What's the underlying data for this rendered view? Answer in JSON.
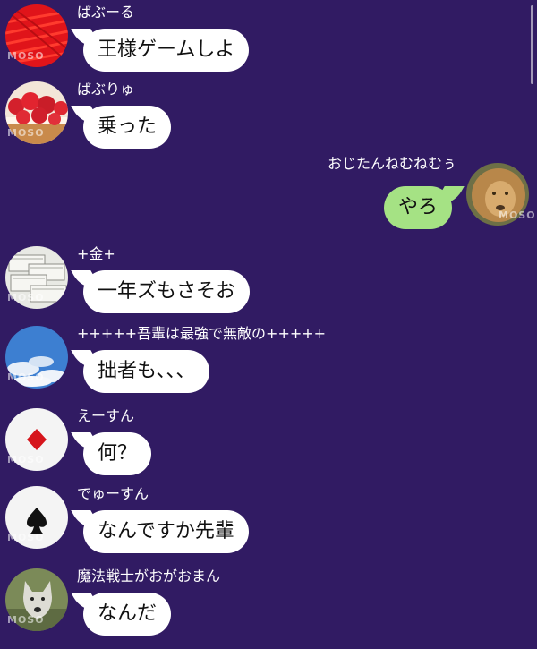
{
  "theme": {
    "background": "#311b63",
    "bubble_incoming": "#ffffff",
    "bubble_outgoing": "#a5e284"
  },
  "watermark": "MOSO",
  "messages": [
    {
      "sender": "ばぶーる",
      "text": "王様ゲームしよ",
      "side": "left",
      "avatar": "red-scribble-avatar"
    },
    {
      "sender": "ばぶりゅ",
      "text": "乗った",
      "side": "left",
      "avatar": "strawberry-tart-avatar"
    },
    {
      "sender": "おじたんねむねむぅ",
      "text": "やろ",
      "side": "right",
      "avatar": "lion-avatar"
    },
    {
      "sender": "+金+",
      "text": "一年ズもさそお",
      "side": "left",
      "avatar": "money-stack-avatar"
    },
    {
      "sender": "+++++吾輩は最強で無敵の+++++",
      "text": "拙者も、、、",
      "side": "left",
      "avatar": "blue-sky-avatar"
    },
    {
      "sender": "えーすん",
      "text": "何？",
      "side": "left",
      "avatar": "diamond-card-avatar"
    },
    {
      "sender": "でゅーすん",
      "text": "なんですか先輩",
      "side": "left",
      "avatar": "spade-card-avatar"
    },
    {
      "sender": "魔法戦士がおがおまん",
      "text": "なんだ",
      "side": "left",
      "avatar": "wolf-avatar"
    }
  ]
}
